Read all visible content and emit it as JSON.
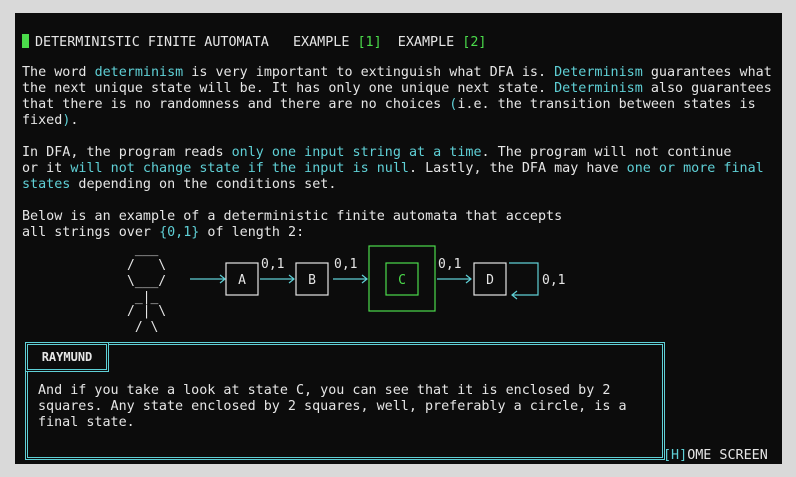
{
  "header": {
    "title": "DETERMINISTIC FINITE AUTOMATA",
    "example1_label": "EXAMPLE",
    "example1_key": "[1]",
    "example2_label": "EXAMPLE",
    "example2_key": "[2]"
  },
  "paragraph1": {
    "l1": [
      "The word ",
      "determinism",
      " is very important to extinguish what DFA is. ",
      "Determinism",
      " guarantees what"
    ],
    "l2": [
      "the next unique state will be. It has only one unique next state. ",
      "Determinism",
      " also guarantees"
    ],
    "l3": [
      "that there is no randomness and there are no choices ",
      "(",
      "i.e. the transition between states is"
    ],
    "l4": [
      "fixed",
      ")",
      "."
    ]
  },
  "paragraph2": {
    "l1": [
      "In DFA, the program reads ",
      "only one input string at a time",
      ". The program will not continue"
    ],
    "l2": [
      "or it ",
      "will not change state if the input is null",
      ". Lastly, the DFA may have ",
      "one or more final"
    ],
    "l3": [
      "states",
      " depending on the conditions set."
    ]
  },
  "paragraph3": {
    "l1": "Below is an example of a deterministic finite automata that accepts",
    "l2": [
      "all strings over ",
      "{0,1}",
      " of length 2:"
    ]
  },
  "diagram": {
    "stick_figure": [
      " ___",
      "/   \\",
      "\\___/",
      " _|_",
      "/ | \\",
      " / \\"
    ],
    "states": [
      "A",
      "B",
      "C",
      "D"
    ],
    "transition_labels": [
      "0,1",
      "0,1",
      "0,1",
      "0,1"
    ],
    "final_state": "C",
    "colors": {
      "final": "#4bdc4b",
      "normal": "#e6e6e6",
      "accent": "#5fd0d6"
    }
  },
  "dialog": {
    "speaker": "RAYMUND",
    "text": "And if you take a look at state C, you can see that it is enclosed by 2 squares. Any state enclosed by 2 squares, well, preferably a circle, is a final state."
  },
  "footer": {
    "home_key": "[H]",
    "home_label": "OME SCREEN"
  }
}
